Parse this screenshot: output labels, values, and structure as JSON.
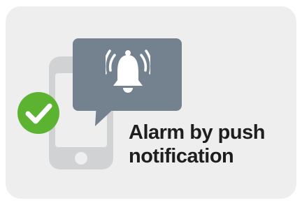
{
  "caption": {
    "line1": "Alarm by push",
    "line2": "notification"
  },
  "icons": {
    "phone": "smartphone-icon",
    "bubble": "chat-bubble-icon",
    "bell": "ringing-bell-icon",
    "check": "check-circle-icon"
  },
  "colors": {
    "card_background": "#eeeeef",
    "phone": "#d0d2d4",
    "bubble": "#73828e",
    "bell": "#ffffff",
    "check": "#5cb332",
    "text": "#1e1e1e"
  }
}
